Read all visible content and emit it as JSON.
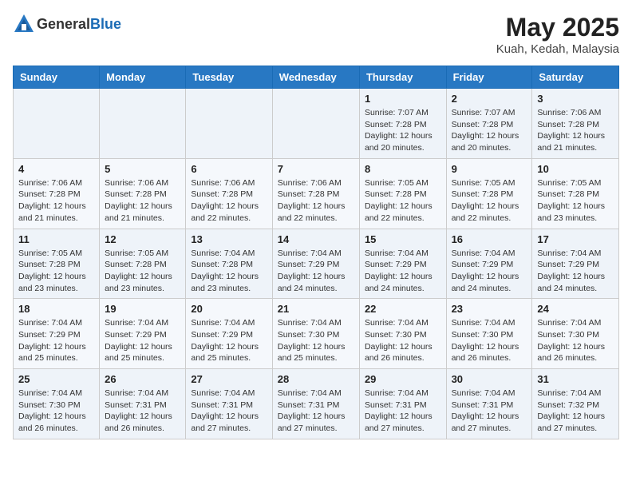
{
  "header": {
    "logo_general": "General",
    "logo_blue": "Blue",
    "month": "May 2025",
    "location": "Kuah, Kedah, Malaysia"
  },
  "weekdays": [
    "Sunday",
    "Monday",
    "Tuesday",
    "Wednesday",
    "Thursday",
    "Friday",
    "Saturday"
  ],
  "weeks": [
    [
      {
        "day": "",
        "info": ""
      },
      {
        "day": "",
        "info": ""
      },
      {
        "day": "",
        "info": ""
      },
      {
        "day": "",
        "info": ""
      },
      {
        "day": "1",
        "info": "Sunrise: 7:07 AM\nSunset: 7:28 PM\nDaylight: 12 hours\nand 20 minutes."
      },
      {
        "day": "2",
        "info": "Sunrise: 7:07 AM\nSunset: 7:28 PM\nDaylight: 12 hours\nand 20 minutes."
      },
      {
        "day": "3",
        "info": "Sunrise: 7:06 AM\nSunset: 7:28 PM\nDaylight: 12 hours\nand 21 minutes."
      }
    ],
    [
      {
        "day": "4",
        "info": "Sunrise: 7:06 AM\nSunset: 7:28 PM\nDaylight: 12 hours\nand 21 minutes."
      },
      {
        "day": "5",
        "info": "Sunrise: 7:06 AM\nSunset: 7:28 PM\nDaylight: 12 hours\nand 21 minutes."
      },
      {
        "day": "6",
        "info": "Sunrise: 7:06 AM\nSunset: 7:28 PM\nDaylight: 12 hours\nand 22 minutes."
      },
      {
        "day": "7",
        "info": "Sunrise: 7:06 AM\nSunset: 7:28 PM\nDaylight: 12 hours\nand 22 minutes."
      },
      {
        "day": "8",
        "info": "Sunrise: 7:05 AM\nSunset: 7:28 PM\nDaylight: 12 hours\nand 22 minutes."
      },
      {
        "day": "9",
        "info": "Sunrise: 7:05 AM\nSunset: 7:28 PM\nDaylight: 12 hours\nand 22 minutes."
      },
      {
        "day": "10",
        "info": "Sunrise: 7:05 AM\nSunset: 7:28 PM\nDaylight: 12 hours\nand 23 minutes."
      }
    ],
    [
      {
        "day": "11",
        "info": "Sunrise: 7:05 AM\nSunset: 7:28 PM\nDaylight: 12 hours\nand 23 minutes."
      },
      {
        "day": "12",
        "info": "Sunrise: 7:05 AM\nSunset: 7:28 PM\nDaylight: 12 hours\nand 23 minutes."
      },
      {
        "day": "13",
        "info": "Sunrise: 7:04 AM\nSunset: 7:28 PM\nDaylight: 12 hours\nand 23 minutes."
      },
      {
        "day": "14",
        "info": "Sunrise: 7:04 AM\nSunset: 7:29 PM\nDaylight: 12 hours\nand 24 minutes."
      },
      {
        "day": "15",
        "info": "Sunrise: 7:04 AM\nSunset: 7:29 PM\nDaylight: 12 hours\nand 24 minutes."
      },
      {
        "day": "16",
        "info": "Sunrise: 7:04 AM\nSunset: 7:29 PM\nDaylight: 12 hours\nand 24 minutes."
      },
      {
        "day": "17",
        "info": "Sunrise: 7:04 AM\nSunset: 7:29 PM\nDaylight: 12 hours\nand 24 minutes."
      }
    ],
    [
      {
        "day": "18",
        "info": "Sunrise: 7:04 AM\nSunset: 7:29 PM\nDaylight: 12 hours\nand 25 minutes."
      },
      {
        "day": "19",
        "info": "Sunrise: 7:04 AM\nSunset: 7:29 PM\nDaylight: 12 hours\nand 25 minutes."
      },
      {
        "day": "20",
        "info": "Sunrise: 7:04 AM\nSunset: 7:29 PM\nDaylight: 12 hours\nand 25 minutes."
      },
      {
        "day": "21",
        "info": "Sunrise: 7:04 AM\nSunset: 7:30 PM\nDaylight: 12 hours\nand 25 minutes."
      },
      {
        "day": "22",
        "info": "Sunrise: 7:04 AM\nSunset: 7:30 PM\nDaylight: 12 hours\nand 26 minutes."
      },
      {
        "day": "23",
        "info": "Sunrise: 7:04 AM\nSunset: 7:30 PM\nDaylight: 12 hours\nand 26 minutes."
      },
      {
        "day": "24",
        "info": "Sunrise: 7:04 AM\nSunset: 7:30 PM\nDaylight: 12 hours\nand 26 minutes."
      }
    ],
    [
      {
        "day": "25",
        "info": "Sunrise: 7:04 AM\nSunset: 7:30 PM\nDaylight: 12 hours\nand 26 minutes."
      },
      {
        "day": "26",
        "info": "Sunrise: 7:04 AM\nSunset: 7:31 PM\nDaylight: 12 hours\nand 26 minutes."
      },
      {
        "day": "27",
        "info": "Sunrise: 7:04 AM\nSunset: 7:31 PM\nDaylight: 12 hours\nand 27 minutes."
      },
      {
        "day": "28",
        "info": "Sunrise: 7:04 AM\nSunset: 7:31 PM\nDaylight: 12 hours\nand 27 minutes."
      },
      {
        "day": "29",
        "info": "Sunrise: 7:04 AM\nSunset: 7:31 PM\nDaylight: 12 hours\nand 27 minutes."
      },
      {
        "day": "30",
        "info": "Sunrise: 7:04 AM\nSunset: 7:31 PM\nDaylight: 12 hours\nand 27 minutes."
      },
      {
        "day": "31",
        "info": "Sunrise: 7:04 AM\nSunset: 7:32 PM\nDaylight: 12 hours\nand 27 minutes."
      }
    ]
  ]
}
